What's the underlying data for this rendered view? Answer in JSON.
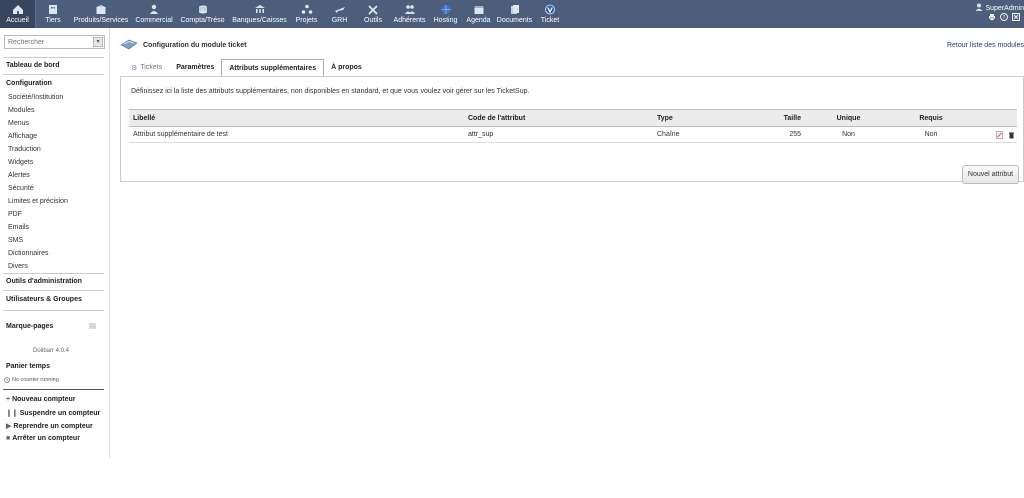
{
  "topbar": {
    "items": [
      {
        "label": "Accueil",
        "icon": "home-icon",
        "active": true
      },
      {
        "label": "Tiers",
        "icon": "building-icon"
      },
      {
        "label": "Produits/Services",
        "icon": "box-icon"
      },
      {
        "label": "Commercial",
        "icon": "person-icon"
      },
      {
        "label": "Compta/Tréso",
        "icon": "coins-icon"
      },
      {
        "label": "Banques/Caisses",
        "icon": "bank-icon"
      },
      {
        "label": "Projets",
        "icon": "projects-icon"
      },
      {
        "label": "GRH",
        "icon": "plane-icon"
      },
      {
        "label": "Outils",
        "icon": "tools-icon"
      },
      {
        "label": "Adhérents",
        "icon": "members-icon"
      },
      {
        "label": "Hosting",
        "icon": "globe-icon"
      },
      {
        "label": "Agenda",
        "icon": "calendar-icon"
      },
      {
        "label": "Documents",
        "icon": "documents-icon"
      },
      {
        "label": "Ticket",
        "icon": "ticket-icon"
      }
    ],
    "user": "SuperAdmin",
    "bar_color": "#4c5e7c"
  },
  "sidebar": {
    "search_placeholder": "Rechercher",
    "dashboard": "Tableau de bord",
    "config_title": "Configuration",
    "config_items": [
      "Société/Institution",
      "Modules",
      "Menus",
      "Affichage",
      "Traduction",
      "Widgets",
      "Alertes",
      "Sécurité",
      "Limites et précision",
      "PDF",
      "Emails",
      "SMS",
      "Dictionnaires",
      "Divers"
    ],
    "admin_tools": "Outils d'administration",
    "users_groups": "Utilisateurs & Groupes",
    "bookmarks": "Marque-pages",
    "version": "Dolibarr 4.0.4",
    "timer_title": "Panier temps",
    "no_counter": "No counter running",
    "timer_actions": [
      "Nouveau compteur",
      "Suspendre un compteur",
      "Reprendre un compteur",
      "Arrêter un compteur"
    ]
  },
  "main": {
    "title": "Configuration du module ticket",
    "back_link": "Retour liste des modules",
    "tabs": [
      "Tickets",
      "Paramètres",
      "Attributs supplémentaires",
      "À propos"
    ],
    "active_tab": "Attributs supplémentaires",
    "description": "Définissez ici la liste des attributs supplémentaires, non disponibles en standard, et que vous voulez voir gérer sur les TicketSup.",
    "table": {
      "headers": [
        "Libellé",
        "Code de l'attribut",
        "Type",
        "Taille",
        "Unique",
        "Requis"
      ],
      "rows": [
        {
          "label": "Attribut supplémentaire de test",
          "code": "attr_sup",
          "type": "Chaîne",
          "size": "255",
          "unique": "Non",
          "required": "Non"
        }
      ]
    },
    "new_button": "Nouvel attribut"
  }
}
